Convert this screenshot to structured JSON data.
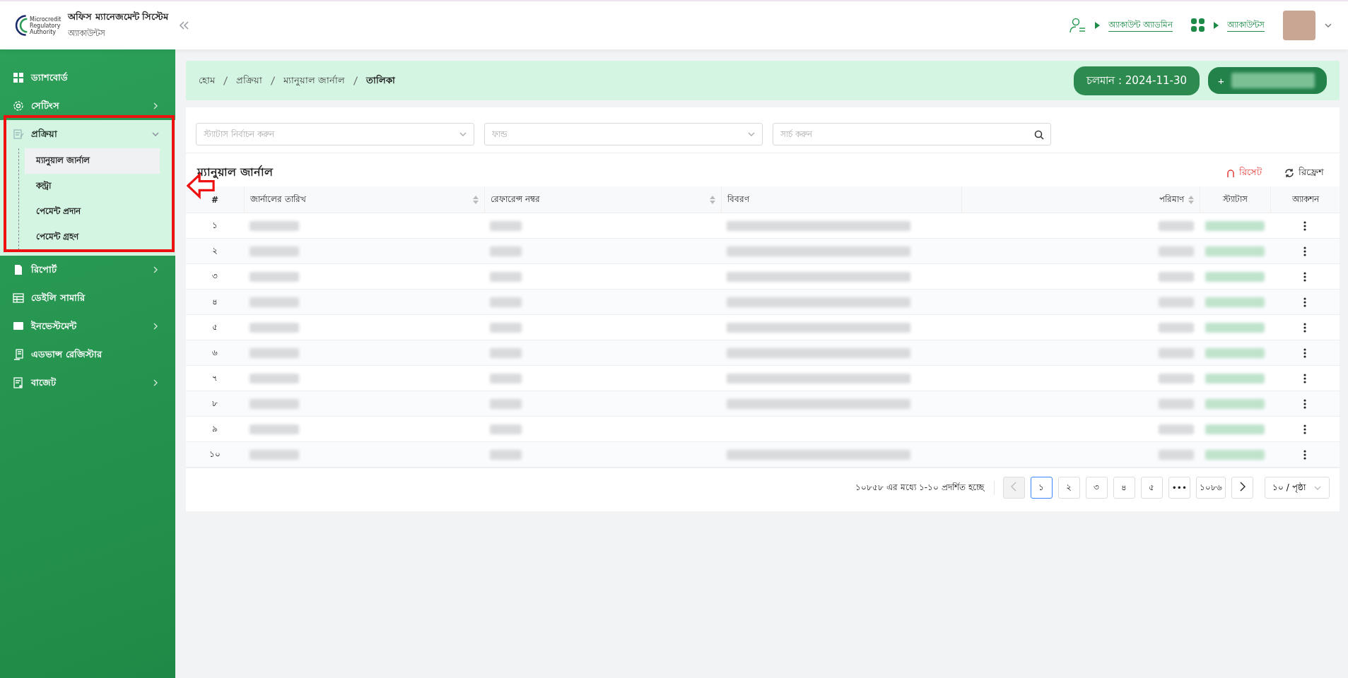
{
  "header": {
    "logo_text": [
      "Microcredit",
      "Regulatory",
      "Authority"
    ],
    "title": "অফিস ম্যানেজমেন্ট সিস্টেম",
    "subtitle": "অ্যাকাউন্টস",
    "links": [
      {
        "label": "অ্যাকাউন্ট অ্যাডমিন"
      },
      {
        "label": "অ্যাকাউন্টস"
      }
    ]
  },
  "sidebar": {
    "items": [
      {
        "label": "ড্যাশবোর্ড",
        "expandable": false,
        "expanded": false
      },
      {
        "label": "সেটিংস",
        "expandable": true,
        "expanded": false
      },
      {
        "label": "প্রক্রিয়া",
        "expandable": true,
        "expanded": true,
        "children": [
          {
            "label": "ম্যানুয়াল জার্নাল",
            "selected": true
          },
          {
            "label": "কন্ট্রা",
            "selected": false
          },
          {
            "label": "পেমেন্ট প্রদান",
            "selected": false
          },
          {
            "label": "পেমেন্ট গ্রহণ",
            "selected": false
          }
        ]
      },
      {
        "label": "রিপোর্ট",
        "expandable": true,
        "expanded": false
      },
      {
        "label": "ডেইলি সামারি",
        "expandable": false,
        "expanded": false
      },
      {
        "label": "ইনভেস্টমেন্ট",
        "expandable": true,
        "expanded": false
      },
      {
        "label": "এডভান্স রেজিস্টার",
        "expandable": false,
        "expanded": false
      },
      {
        "label": "বাজেট",
        "expandable": true,
        "expanded": false
      }
    ]
  },
  "breadcrumb": [
    "হোম",
    "প্রক্রিয়া",
    "ম্যানুয়াল জার্নাল",
    "তালিকা"
  ],
  "fiscal_badge": "চলমান : 2024-11-30",
  "add_button": "+",
  "filters": [
    {
      "kind": "select",
      "placeholder": "স্ট্যাটাস নির্বাচন করুন"
    },
    {
      "kind": "select",
      "placeholder": "ফান্ড"
    },
    {
      "kind": "search",
      "placeholder": "সার্চ করুন"
    }
  ],
  "table": {
    "title": "ম্যানুয়াল জার্নাল",
    "reset": "রিসেট",
    "refresh": "রিফ্রেশ",
    "columns": [
      {
        "label": "#",
        "sortable": false
      },
      {
        "label": "জার্নালের তারিখ",
        "sortable": true
      },
      {
        "label": "রেফারেন্স নম্বর",
        "sortable": true
      },
      {
        "label": "বিবরণ",
        "sortable": false
      },
      {
        "label": "পরিমাণ",
        "sortable": true
      },
      {
        "label": "স্ট্যাটাস",
        "sortable": false
      },
      {
        "label": "অ্যাকশন",
        "sortable": false
      }
    ],
    "rows": [
      {
        "number": "১"
      },
      {
        "number": "২"
      },
      {
        "number": "৩"
      },
      {
        "number": "৪"
      },
      {
        "number": "৫"
      },
      {
        "number": "৬"
      },
      {
        "number": "৭"
      },
      {
        "number": "৮"
      },
      {
        "number": "৯"
      },
      {
        "number": "১০"
      }
    ]
  },
  "pagination": {
    "summary": "১০৮৫৮ এর মধ্যে ১-১০ প্রদর্শিত হচ্ছে",
    "prev_disabled": true,
    "pages": [
      {
        "label": "১",
        "selected": true
      },
      {
        "label": "২",
        "selected": false
      },
      {
        "label": "৩",
        "selected": false
      },
      {
        "label": "৪",
        "selected": false
      },
      {
        "label": "৫",
        "selected": false
      },
      {
        "label": "•••",
        "selected": false
      },
      {
        "label": "১০৮৬",
        "selected": false
      }
    ],
    "page_size": "১০ / পৃষ্ঠা"
  }
}
